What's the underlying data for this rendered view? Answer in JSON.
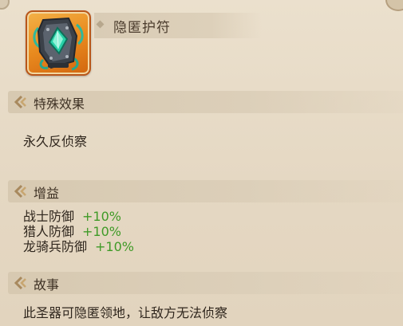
{
  "item": {
    "name": "隐匿护符",
    "icon": "amulet-icon"
  },
  "sections": {
    "special": {
      "title": "特殊效果",
      "text": "永久反侦察"
    },
    "buffs": {
      "title": "增益",
      "rows": [
        {
          "label": "战士防御",
          "value": "+10%"
        },
        {
          "label": "猎人防御",
          "value": "+10%"
        },
        {
          "label": "龙骑兵防御",
          "value": "+10%"
        }
      ]
    },
    "story": {
      "title": "故事",
      "text": "此圣器可隐匿领地，让敌方无法侦察"
    }
  },
  "colors": {
    "background": "#e6dac6",
    "buff_value": "#3f9a27",
    "icon_frame": "#e98b1f"
  }
}
